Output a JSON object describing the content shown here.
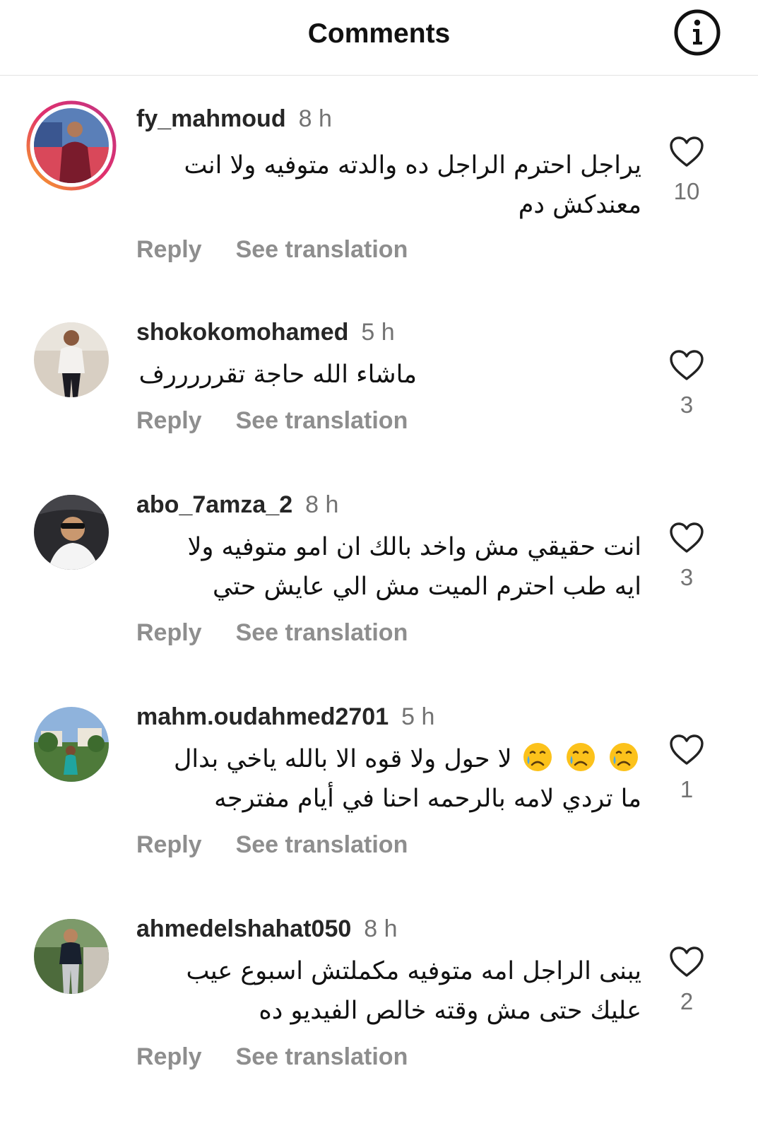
{
  "header": {
    "title": "Comments",
    "info_icon": "info-icon"
  },
  "comments": [
    {
      "username": "fy_mahmoud",
      "time": "8 h",
      "text": "يراجل احترم الراجل ده والدته متوفيه ولا انت معندكش دم",
      "likes": "10",
      "has_story": true,
      "reply_label": "Reply",
      "translate_label": "See translation"
    },
    {
      "username": "shokokomohamed",
      "time": "5 h",
      "text": "ماشاء الله حاجة تقرررررف",
      "likes": "3",
      "has_story": false,
      "reply_label": "Reply",
      "translate_label": "See translation"
    },
    {
      "username": "abo_7amza_2",
      "time": "8 h",
      "text": "انت حقيقي مش واخد بالك ان امو متوفيه ولا ايه طب احترم الميت مش الي عايش حتي",
      "likes": "3",
      "has_story": false,
      "reply_label": "Reply",
      "translate_label": "See translation"
    },
    {
      "username": "mahm.oudahmed2701",
      "time": "5 h",
      "text_before_emoji": "",
      "text": "لا حول ولا قوه الا بالله ياخي بدال ما تردي لامه بالرحمه احنا في أيام مفترجه",
      "emoji": "crying-face-emoji",
      "emoji_count": 3,
      "likes": "1",
      "has_story": false,
      "reply_label": "Reply",
      "translate_label": "See translation"
    },
    {
      "username": "ahmedelshahat050",
      "time": "8 h",
      "text": "يبنى الراجل امه متوفيه مكملتش اسبوع عيب عليك حتى مش وقته خالص الفيديو ده",
      "likes": "2",
      "has_story": false,
      "reply_label": "Reply",
      "translate_label": "See translation"
    }
  ],
  "colors": {
    "story_ring_start": "#f9a825",
    "story_ring_end": "#c13584",
    "muted": "#8e8e8e"
  }
}
